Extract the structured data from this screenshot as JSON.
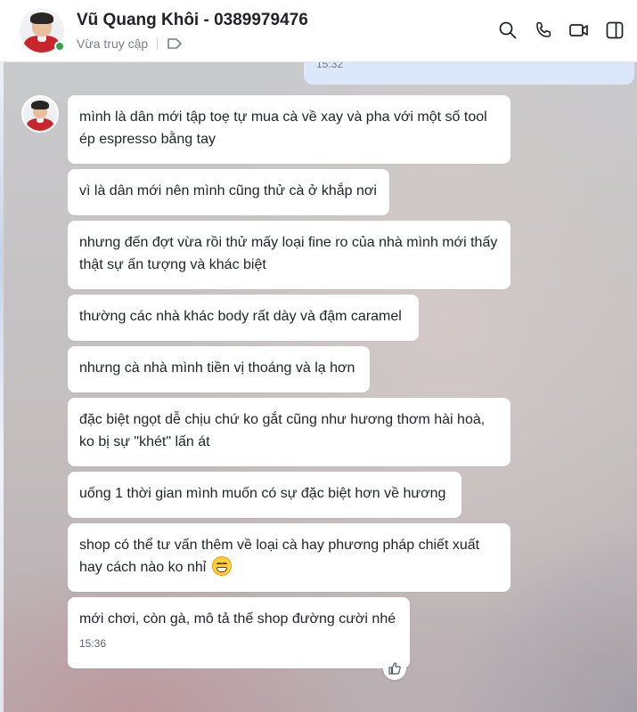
{
  "header": {
    "contact_name": "Vũ Quang Khôi - 0389979476",
    "status": "Vừa truy cập",
    "actions": [
      {
        "name": "search-icon"
      },
      {
        "name": "phone-icon"
      },
      {
        "name": "video-call-icon"
      },
      {
        "name": "side-panel-icon"
      }
    ]
  },
  "previous_message": {
    "time": "15:32"
  },
  "messages": [
    {
      "text": "mình là dân mới tập toẹ tự mua cà về xay và pha với một số tool ép espresso bằng tay"
    },
    {
      "text": "vì là dân mới nên mình cũng thử cà ở khắp nơi"
    },
    {
      "text": "nhưng đến đợt vừa rồi thử mấy loại fine ro của nhà mình mới thấy thật sự ấn tượng và khác biệt"
    },
    {
      "text": "thường các nhà khác body rất dày và đậm caramel"
    },
    {
      "text": "nhưng cà nhà mình tiền vị thoáng và lạ hơn"
    },
    {
      "text": "đặc biệt ngọt dễ chịu chứ ko gắt cũng như hương thơm hài hoà, ko bị sự \"khét\" lấn át"
    },
    {
      "text": "uống 1 thời gian mình muốn có sự đặc biệt hơn về hương"
    },
    {
      "text": "shop có thể tư vấn thêm về loại cà hay phương pháp chiết xuất hay cách nào ko nhỉ",
      "emoji": "grinning-face-emoji"
    },
    {
      "text": "mới chơi, còn gà, mô tả thế shop đường cười nhé",
      "time": "15:36"
    }
  ],
  "colors": {
    "accent_blue": "#dbe8fb",
    "online_green": "#30a14e",
    "bubble_bg": "#ffffff",
    "text_primary": "#1f2328",
    "text_muted": "#7a7f87"
  }
}
